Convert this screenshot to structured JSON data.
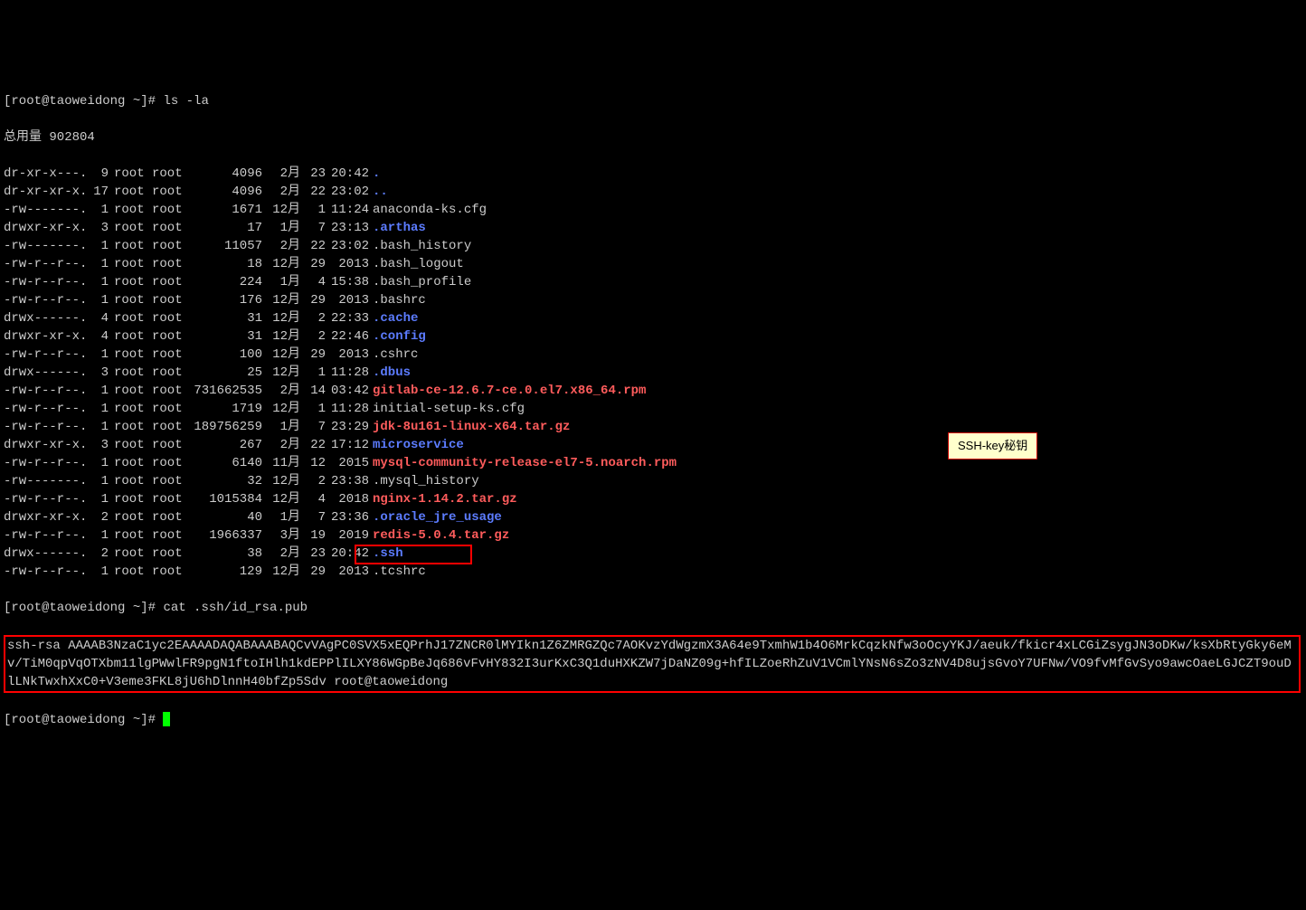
{
  "prompt1": "[root@taoweidong ~]# ",
  "cmd1": "ls -la",
  "total_line": "总用量 902804",
  "files": [
    {
      "perm": "dr-xr-x---.",
      "l": "9",
      "o": "root",
      "g": "root",
      "sz": "4096",
      "m": "2月",
      "d": "23",
      "t": "20:42",
      "n": ".",
      "c": "blue"
    },
    {
      "perm": "dr-xr-xr-x.",
      "l": "17",
      "o": "root",
      "g": "root",
      "sz": "4096",
      "m": "2月",
      "d": "22",
      "t": "23:02",
      "n": "..",
      "c": "blue"
    },
    {
      "perm": "-rw-------.",
      "l": "1",
      "o": "root",
      "g": "root",
      "sz": "1671",
      "m": "12月",
      "d": "1",
      "t": "11:24",
      "n": "anaconda-ks.cfg",
      "c": "white"
    },
    {
      "perm": "drwxr-xr-x.",
      "l": "3",
      "o": "root",
      "g": "root",
      "sz": "17",
      "m": "1月",
      "d": "7",
      "t": "23:13",
      "n": ".arthas",
      "c": "blue"
    },
    {
      "perm": "-rw-------.",
      "l": "1",
      "o": "root",
      "g": "root",
      "sz": "11057",
      "m": "2月",
      "d": "22",
      "t": "23:02",
      "n": ".bash_history",
      "c": "white"
    },
    {
      "perm": "-rw-r--r--.",
      "l": "1",
      "o": "root",
      "g": "root",
      "sz": "18",
      "m": "12月",
      "d": "29",
      "t": "2013",
      "n": ".bash_logout",
      "c": "white"
    },
    {
      "perm": "-rw-r--r--.",
      "l": "1",
      "o": "root",
      "g": "root",
      "sz": "224",
      "m": "1月",
      "d": "4",
      "t": "15:38",
      "n": ".bash_profile",
      "c": "white"
    },
    {
      "perm": "-rw-r--r--.",
      "l": "1",
      "o": "root",
      "g": "root",
      "sz": "176",
      "m": "12月",
      "d": "29",
      "t": "2013",
      "n": ".bashrc",
      "c": "white"
    },
    {
      "perm": "drwx------.",
      "l": "4",
      "o": "root",
      "g": "root",
      "sz": "31",
      "m": "12月",
      "d": "2",
      "t": "22:33",
      "n": ".cache",
      "c": "blue"
    },
    {
      "perm": "drwxr-xr-x.",
      "l": "4",
      "o": "root",
      "g": "root",
      "sz": "31",
      "m": "12月",
      "d": "2",
      "t": "22:46",
      "n": ".config",
      "c": "blue"
    },
    {
      "perm": "-rw-r--r--.",
      "l": "1",
      "o": "root",
      "g": "root",
      "sz": "100",
      "m": "12月",
      "d": "29",
      "t": "2013",
      "n": ".cshrc",
      "c": "white"
    },
    {
      "perm": "drwx------.",
      "l": "3",
      "o": "root",
      "g": "root",
      "sz": "25",
      "m": "12月",
      "d": "1",
      "t": "11:28",
      "n": ".dbus",
      "c": "blue"
    },
    {
      "perm": "-rw-r--r--.",
      "l": "1",
      "o": "root",
      "g": "root",
      "sz": "731662535",
      "m": "2月",
      "d": "14",
      "t": "03:42",
      "n": "gitlab-ce-12.6.7-ce.0.el7.x86_64.rpm",
      "c": "red"
    },
    {
      "perm": "-rw-r--r--.",
      "l": "1",
      "o": "root",
      "g": "root",
      "sz": "1719",
      "m": "12月",
      "d": "1",
      "t": "11:28",
      "n": "initial-setup-ks.cfg",
      "c": "white"
    },
    {
      "perm": "-rw-r--r--.",
      "l": "1",
      "o": "root",
      "g": "root",
      "sz": "189756259",
      "m": "1月",
      "d": "7",
      "t": "23:29",
      "n": "jdk-8u161-linux-x64.tar.gz",
      "c": "red"
    },
    {
      "perm": "drwxr-xr-x.",
      "l": "3",
      "o": "root",
      "g": "root",
      "sz": "267",
      "m": "2月",
      "d": "22",
      "t": "17:12",
      "n": "microservice",
      "c": "blue"
    },
    {
      "perm": "-rw-r--r--.",
      "l": "1",
      "o": "root",
      "g": "root",
      "sz": "6140",
      "m": "11月",
      "d": "12",
      "t": "2015",
      "n": "mysql-community-release-el7-5.noarch.rpm",
      "c": "red"
    },
    {
      "perm": "-rw-------.",
      "l": "1",
      "o": "root",
      "g": "root",
      "sz": "32",
      "m": "12月",
      "d": "2",
      "t": "23:38",
      "n": ".mysql_history",
      "c": "white"
    },
    {
      "perm": "-rw-r--r--.",
      "l": "1",
      "o": "root",
      "g": "root",
      "sz": "1015384",
      "m": "12月",
      "d": "4",
      "t": "2018",
      "n": "nginx-1.14.2.tar.gz",
      "c": "red"
    },
    {
      "perm": "drwxr-xr-x.",
      "l": "2",
      "o": "root",
      "g": "root",
      "sz": "40",
      "m": "1月",
      "d": "7",
      "t": "23:36",
      "n": ".oracle_jre_usage",
      "c": "blue"
    },
    {
      "perm": "-rw-r--r--.",
      "l": "1",
      "o": "root",
      "g": "root",
      "sz": "1966337",
      "m": "3月",
      "d": "19",
      "t": "2019",
      "n": "redis-5.0.4.tar.gz",
      "c": "red"
    },
    {
      "perm": "drwx------.",
      "l": "2",
      "o": "root",
      "g": "root",
      "sz": "38",
      "m": "2月",
      "d": "23",
      "t": "20:42",
      "n": ".ssh",
      "c": "blue"
    },
    {
      "perm": "-rw-r--r--.",
      "l": "1",
      "o": "root",
      "g": "root",
      "sz": "129",
      "m": "12月",
      "d": "29",
      "t": "2013",
      "n": ".tcshrc",
      "c": "white"
    }
  ],
  "prompt2": "[root@taoweidong ~]# ",
  "cmd2": "cat .ssh/id_rsa.pub",
  "rsa": "ssh-rsa AAAAB3NzaC1yc2EAAAADAQABAAABAQCvVAgPC0SVX5xEQPrhJ17ZNCR0lMYIkn1Z6ZMRGZQc7AOKvzYdWgzmX3A64e9TxmhW1b4O6MrkCqzkNfw3oOcyYKJ/aeuk/fkicr4xLCGiZsygJN3oDKw/ksXbRtyGky6eMv/TiM0qpVqOTXbm11lgPWwlFR9pgN1ftoIHlh1kdEPPlILXY86WGpBeJq686vFvHY832I3urKxC3Q1duHXKZW7jDaNZ09g+hfILZoeRhZuV1VCmlYNsN6sZo3zNV4D8ujsGvoY7UFNw/VO9fvMfGvSyo9awcOaeLGJCZT9ouDlLNkTwxhXxC0+V3eme3FKL8jU6hDlnnH40bfZp5Sdv root@taoweidong",
  "prompt3": "[root@taoweidong ~]# ",
  "tooltip": "SSH-key秘钥"
}
